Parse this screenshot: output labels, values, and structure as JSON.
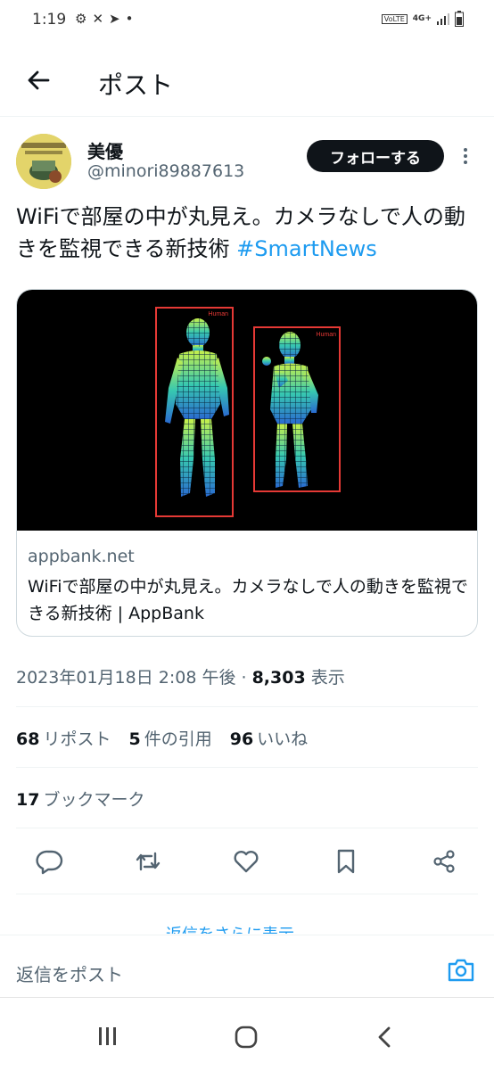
{
  "status_bar": {
    "time": "1:19",
    "network": "4G+",
    "volte": "VoLTE"
  },
  "header": {
    "title": "ポスト"
  },
  "author": {
    "name": "美優",
    "handle": "@minori89887613",
    "follow_label": "フォローする"
  },
  "tweet": {
    "text": "WiFiで部屋の中が丸見え。カメラなしで人の動きを監視できる新技術",
    "hashtag": "#SmartNews"
  },
  "card": {
    "image_labels": [
      "Human",
      "Human"
    ],
    "domain": "appbank.net",
    "title": "WiFiで部屋の中が丸見え。カメラなしで人の動きを監視できる新技術 | AppBank"
  },
  "meta": {
    "datetime": "2023年01月18日 2:08 午後",
    "views_count": "8,303",
    "views_label": "表示"
  },
  "stats": {
    "reposts_count": "68",
    "reposts_label": "リポスト",
    "quotes_count": "5",
    "quotes_label": "件の引用",
    "likes_count": "96",
    "likes_label": "いいね",
    "bookmarks_count": "17",
    "bookmarks_label": "ブックマーク"
  },
  "partial_link": "返信をさらに表示",
  "reply": {
    "placeholder": "返信をポスト"
  },
  "colors": {
    "accent": "#1d9bf0",
    "text": "#0f1419",
    "secondary": "#536471",
    "detection_box": "#e53935"
  }
}
